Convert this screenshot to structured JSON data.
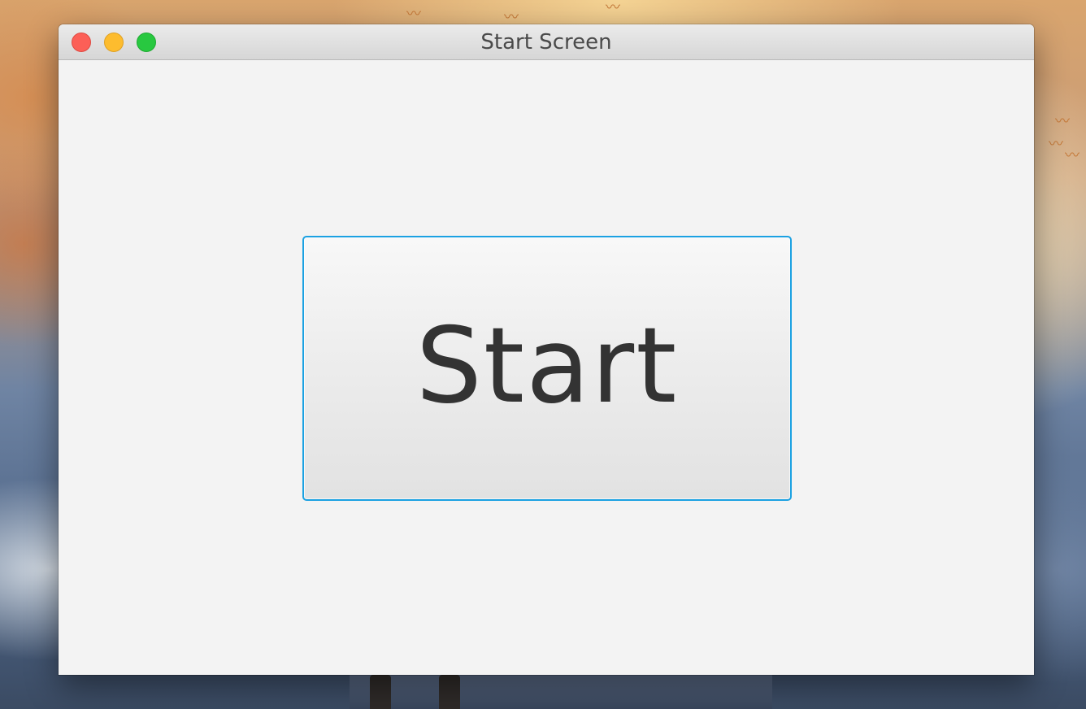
{
  "window": {
    "title": "Start Screen"
  },
  "main": {
    "start_button_label": "Start"
  },
  "colors": {
    "focus_border": "#1ba1e2",
    "close": "#fc5f57",
    "minimize": "#fdbc2e",
    "zoom": "#28c840"
  }
}
